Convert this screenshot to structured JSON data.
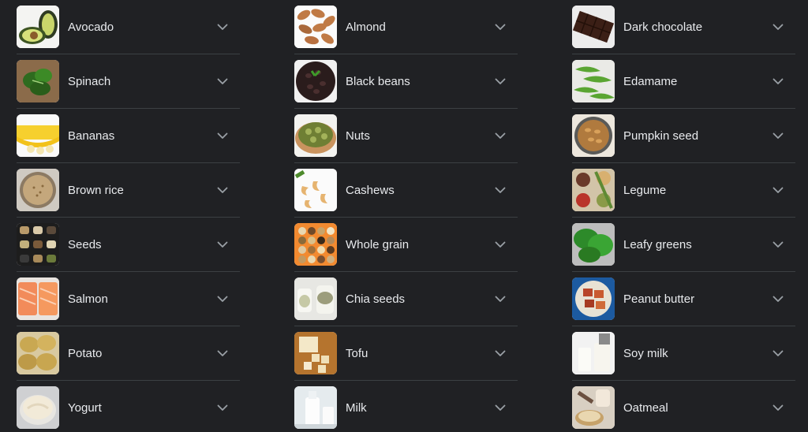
{
  "colors": {
    "background": "#202124",
    "divider": "#3c4043",
    "text": "#e8eaed",
    "chevron": "#9aa0a6"
  },
  "columns": [
    {
      "items": [
        {
          "label": "Avocado",
          "thumb": "avocado",
          "expand_icon": "chevron-down-icon"
        },
        {
          "label": "Spinach",
          "thumb": "spinach",
          "expand_icon": "chevron-down-icon"
        },
        {
          "label": "Bananas",
          "thumb": "bananas",
          "expand_icon": "chevron-down-icon"
        },
        {
          "label": "Brown rice",
          "thumb": "brown-rice",
          "expand_icon": "chevron-down-icon"
        },
        {
          "label": "Seeds",
          "thumb": "seeds",
          "expand_icon": "chevron-down-icon"
        },
        {
          "label": "Salmon",
          "thumb": "salmon",
          "expand_icon": "chevron-down-icon"
        },
        {
          "label": "Potato",
          "thumb": "potato",
          "expand_icon": "chevron-down-icon"
        },
        {
          "label": "Yogurt",
          "thumb": "yogurt",
          "expand_icon": "chevron-down-icon"
        }
      ]
    },
    {
      "items": [
        {
          "label": "Almond",
          "thumb": "almond",
          "expand_icon": "chevron-down-icon"
        },
        {
          "label": "Black beans",
          "thumb": "black-beans",
          "expand_icon": "chevron-down-icon"
        },
        {
          "label": "Nuts",
          "thumb": "nuts",
          "expand_icon": "chevron-down-icon"
        },
        {
          "label": "Cashews",
          "thumb": "cashews",
          "expand_icon": "chevron-down-icon"
        },
        {
          "label": "Whole grain",
          "thumb": "whole-grain",
          "expand_icon": "chevron-down-icon"
        },
        {
          "label": "Chia seeds",
          "thumb": "chia-seeds",
          "expand_icon": "chevron-down-icon"
        },
        {
          "label": "Tofu",
          "thumb": "tofu",
          "expand_icon": "chevron-down-icon"
        },
        {
          "label": "Milk",
          "thumb": "milk",
          "expand_icon": "chevron-down-icon"
        }
      ]
    },
    {
      "items": [
        {
          "label": "Dark chocolate",
          "thumb": "dark-chocolate",
          "expand_icon": "chevron-down-icon"
        },
        {
          "label": "Edamame",
          "thumb": "edamame",
          "expand_icon": "chevron-down-icon"
        },
        {
          "label": "Pumpkin seed",
          "thumb": "pumpkin-seed",
          "expand_icon": "chevron-down-icon"
        },
        {
          "label": "Legume",
          "thumb": "legume",
          "expand_icon": "chevron-down-icon"
        },
        {
          "label": "Leafy greens",
          "thumb": "leafy-greens",
          "expand_icon": "chevron-down-icon"
        },
        {
          "label": "Peanut butter",
          "thumb": "peanut-butter",
          "expand_icon": "chevron-down-icon"
        },
        {
          "label": "Soy milk",
          "thumb": "soy-milk",
          "expand_icon": "chevron-down-icon"
        },
        {
          "label": "Oatmeal",
          "thumb": "oatmeal",
          "expand_icon": "chevron-down-icon"
        }
      ]
    }
  ]
}
